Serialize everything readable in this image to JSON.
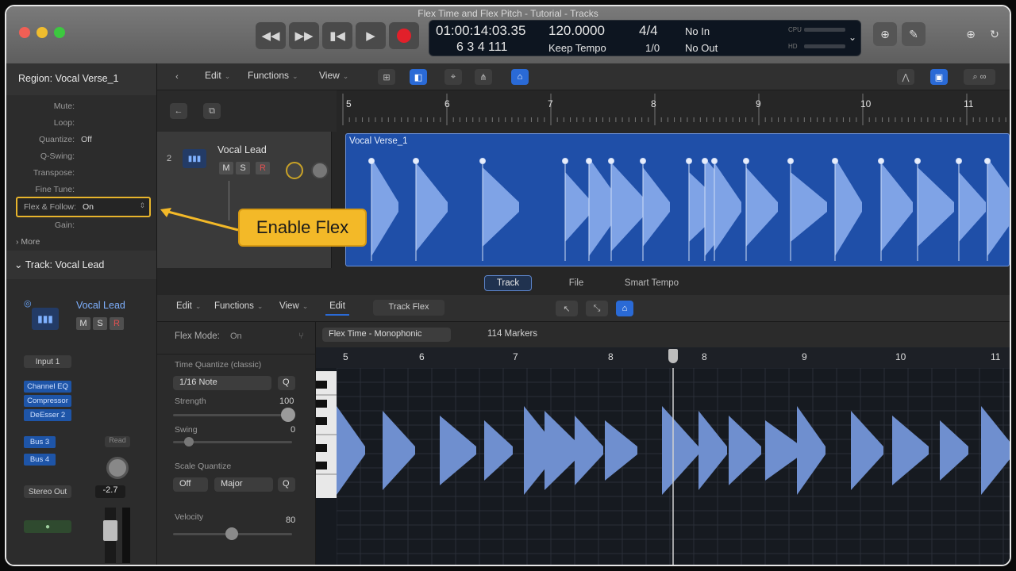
{
  "window": {
    "title": "Flex Time and Flex Pitch - Tutorial - Tracks"
  },
  "transport": {
    "buttons": [
      "rewind",
      "fast-forward",
      "go-to-start",
      "play",
      "record"
    ],
    "lcd": {
      "timecode": "01:00:14:03.35",
      "bars": "6 3 4 111",
      "tempo": "120.0000",
      "tempo_mode": "Keep Tempo",
      "signature": "4/4",
      "division": "1/0",
      "in_label": "No In",
      "out_label": "No Out",
      "cpu_label": "CPU",
      "hd_label": "HD"
    }
  },
  "inspector": {
    "region_title": "Region: Vocal Verse_1",
    "params": [
      {
        "label": "Mute:",
        "value": ""
      },
      {
        "label": "Loop:",
        "value": ""
      },
      {
        "label": "Quantize:",
        "value": "Off"
      },
      {
        "label": "Q-Swing:",
        "value": ""
      },
      {
        "label": "Transpose:",
        "value": ""
      },
      {
        "label": "Fine Tune:",
        "value": ""
      }
    ],
    "flex": {
      "label": "Flex & Follow:",
      "value": "On"
    },
    "gain_label": "Gain:",
    "more_label": "More",
    "track_title": "Track: Vocal Lead",
    "channel": {
      "name": "Vocal Lead",
      "input": "Input 1",
      "plugins": [
        "Channel EQ",
        "Compressor",
        "DeEsser 2"
      ],
      "sends": [
        "Bus 3",
        "Bus 4"
      ],
      "output": "Stereo Out",
      "fader_value": "-2.7",
      "read_label": "Read",
      "m": "M",
      "s": "S",
      "r": "R"
    }
  },
  "tracks_toolbar": {
    "menus": [
      "Edit",
      "Functions",
      "View"
    ]
  },
  "ruler": {
    "bars": [
      "5",
      "6",
      "7",
      "8",
      "9",
      "10",
      "11"
    ]
  },
  "track": {
    "number": "2",
    "name": "Vocal Lead",
    "m": "M",
    "s": "S",
    "r": "R"
  },
  "region": {
    "name": "Vocal Verse_1"
  },
  "callout": {
    "text": "Enable Flex"
  },
  "editor_tabs": [
    {
      "label": "Track",
      "active": true
    },
    {
      "label": "File",
      "active": false
    },
    {
      "label": "Smart Tempo",
      "active": false
    }
  ],
  "editor_toolbar": {
    "menus": [
      "Edit",
      "Functions",
      "View"
    ],
    "edit_button": "Edit",
    "track_flex_button": "Track Flex"
  },
  "editor_side": {
    "flex_mode_label": "Flex Mode:",
    "flex_mode_value": "On",
    "time_quantize_label": "Time Quantize (classic)",
    "note_value": "1/16 Note",
    "q_label": "Q",
    "strength_label": "Strength",
    "strength_value": "100",
    "swing_label": "Swing",
    "swing_value": "0",
    "scale_quantize_label": "Scale Quantize",
    "scale_off": "Off",
    "scale_major": "Major",
    "scale_q": "Q",
    "velocity_label": "Velocity",
    "velocity_value": "80"
  },
  "flex_header": {
    "algorithm": "Flex Time - Monophonic",
    "markers": "114 Markers"
  },
  "lower_ruler": {
    "bars": [
      "5",
      "6",
      "7",
      "8",
      "8",
      "9",
      "10",
      "11"
    ]
  },
  "colors": {
    "accent": "#2a6ad6",
    "callout": "#f3b928",
    "region": "#1f4fa8"
  }
}
